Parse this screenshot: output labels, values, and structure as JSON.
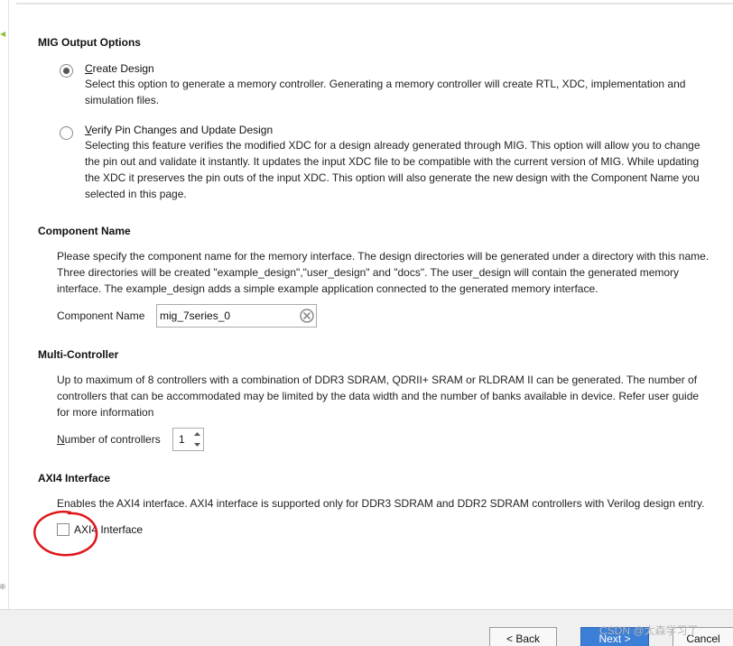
{
  "mig_output_options": {
    "title": "MIG Output Options",
    "create_design": {
      "label": "Create Design",
      "selected": true,
      "description": "Select this option to generate a memory controller. Generating a memory controller will create RTL, XDC, implementation and simulation files."
    },
    "verify_pin_changes": {
      "label": "Verify Pin Changes and Update Design",
      "selected": false,
      "description": "Selecting this feature verifies the modified XDC for a design already generated through MIG. This option will allow you to change the pin out and validate it instantly. It updates the input XDC file to be compatible with the current version of MIG. While updating the XDC it preserves the pin outs of the input XDC. This option will also generate the new design with the Component Name you selected in this page."
    }
  },
  "component_name": {
    "title": "Component Name",
    "description": "Please specify the component name for the memory interface. The design directories will be generated under a directory with this name. Three directories will be created \"example_design\",\"user_design\" and \"docs\". The user_design will contain the generated memory interface. The example_design adds a simple example application connected to the generated memory interface.",
    "field_label": "Component Name",
    "value": "mig_7series_0",
    "clear_icon": "clear-circle-icon"
  },
  "multi_controller": {
    "title": "Multi-Controller",
    "description": "Up to maximum of 8 controllers with a combination of DDR3 SDRAM, QDRII+ SRAM or RLDRAM II can be generated. The number of controllers that can be accommodated may be limited by the data width and the number of banks available in device. Refer user guide for more information",
    "field_label": "Number of controllers",
    "value": "1"
  },
  "axi4_interface": {
    "title": "AXI4 Interface",
    "description": "Enables the AXI4 interface. AXI4 interface is supported only for DDR3 SDRAM and DDR2 SDRAM controllers with Verilog design entry.",
    "checkbox_label": "AXI4 Interface",
    "checked": false,
    "annotation_color": "#e0161b"
  },
  "footer": {
    "back_label": "< Back",
    "next_label": "Next >",
    "cancel_label": "Cancel",
    "watermark": "CSDN @太森学习了"
  },
  "colors": {
    "next_button": "#3b7fd6",
    "footer_bg": "#f0f0f0"
  }
}
